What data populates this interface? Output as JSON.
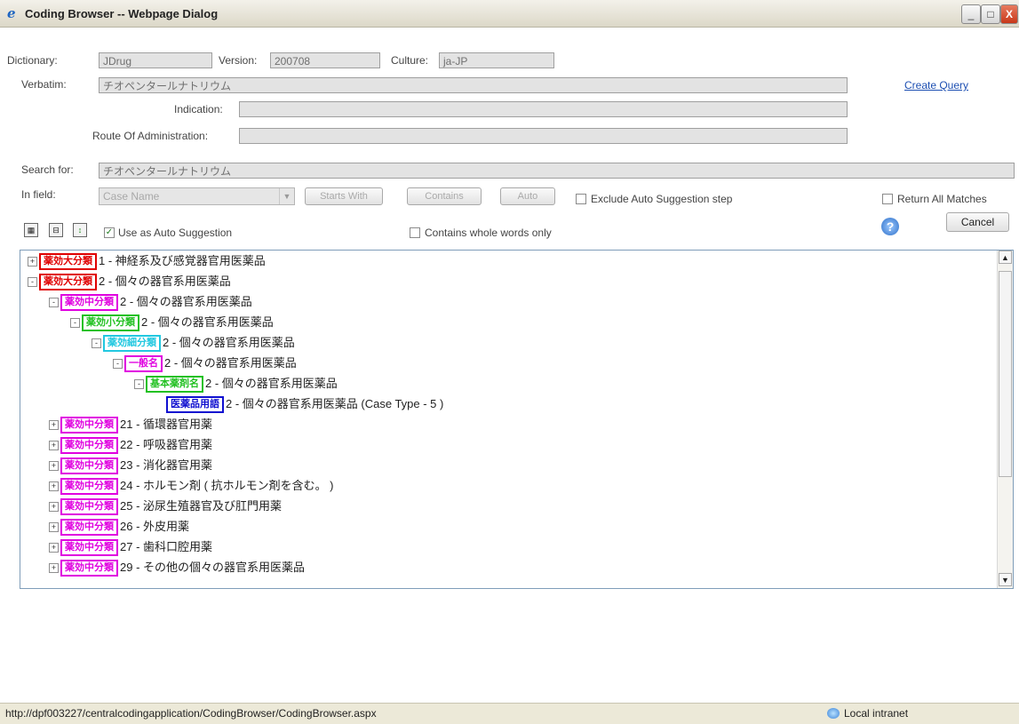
{
  "window": {
    "title": "Coding Browser -- Webpage Dialog",
    "minimize": "_",
    "maximize": "□",
    "close": "X"
  },
  "form": {
    "dictionary_label": "Dictionary:",
    "dictionary_value": "JDrug",
    "version_label": "Version:",
    "version_value": "200708",
    "culture_label": "Culture:",
    "culture_value": "ja-JP",
    "verbatim_label": "Verbatim:",
    "verbatim_value": "チオペンタールナトリウム",
    "indication_label": "Indication:",
    "route_label": "Route Of Administration:",
    "create_query": "Create Query",
    "search_label": "Search for:",
    "search_value": "チオペンタールナトリウム",
    "infield_label": "In field:",
    "infield_value": "Case Name",
    "starts_with": "Starts With",
    "contains": "Contains",
    "auto": "Auto",
    "exclude_label": "Exclude Auto Suggestion step",
    "return_all_label": "Return All Matches",
    "use_auto_label": "Use as Auto Suggestion",
    "whole_words_label": "Contains whole words only",
    "cancel": "Cancel"
  },
  "tree": [
    {
      "indent": 0,
      "expander": "+",
      "tag": "薬効大分類",
      "color": "#e00000",
      "text": "1 - 神経系及び感覚器官用医薬品"
    },
    {
      "indent": 0,
      "expander": "-",
      "tag": "薬効大分類",
      "color": "#e00000",
      "text": "2 - 個々の器官系用医薬品"
    },
    {
      "indent": 1,
      "expander": "-",
      "tag": "薬効中分類",
      "color": "#e000e0",
      "text": "2 - 個々の器官系用医薬品"
    },
    {
      "indent": 2,
      "expander": "-",
      "tag": "薬効小分類",
      "color": "#22c122",
      "text": "2 - 個々の器官系用医薬品"
    },
    {
      "indent": 3,
      "expander": "-",
      "tag": "薬効細分類",
      "color": "#22c8e0",
      "text": "2 - 個々の器官系用医薬品"
    },
    {
      "indent": 4,
      "expander": "-",
      "tag": "一般名",
      "color": "#e000e0",
      "text": "2 - 個々の器官系用医薬品"
    },
    {
      "indent": 5,
      "expander": "-",
      "tag": "基本薬剤名",
      "color": "#22c122",
      "text": "2 - 個々の器官系用医薬品"
    },
    {
      "indent": 6,
      "expander": "",
      "tag": "医薬品用語",
      "color": "#1010d0",
      "text": "2 - 個々の器官系用医薬品 (Case Type - 5 )"
    },
    {
      "indent": 1,
      "expander": "+",
      "tag": "薬効中分類",
      "color": "#e000e0",
      "text": "21 - 循環器官用薬"
    },
    {
      "indent": 1,
      "expander": "+",
      "tag": "薬効中分類",
      "color": "#e000e0",
      "text": "22 - 呼吸器官用薬"
    },
    {
      "indent": 1,
      "expander": "+",
      "tag": "薬効中分類",
      "color": "#e000e0",
      "text": "23 - 消化器官用薬"
    },
    {
      "indent": 1,
      "expander": "+",
      "tag": "薬効中分類",
      "color": "#e000e0",
      "text": "24 - ホルモン剤 ( 抗ホルモン剤を含む。 )"
    },
    {
      "indent": 1,
      "expander": "+",
      "tag": "薬効中分類",
      "color": "#e000e0",
      "text": "25 - 泌尿生殖器官及び肛門用薬"
    },
    {
      "indent": 1,
      "expander": "+",
      "tag": "薬効中分類",
      "color": "#e000e0",
      "text": "26 - 外皮用薬"
    },
    {
      "indent": 1,
      "expander": "+",
      "tag": "薬効中分類",
      "color": "#e000e0",
      "text": "27 - 歯科口腔用薬"
    },
    {
      "indent": 1,
      "expander": "+",
      "tag": "薬効中分類",
      "color": "#e000e0",
      "text": "29 - その他の個々の器官系用医薬品"
    }
  ],
  "status": {
    "url": "http://dpf003227/centralcodingapplication/CodingBrowser/CodingBrowser.aspx",
    "zone": "Local intranet"
  }
}
